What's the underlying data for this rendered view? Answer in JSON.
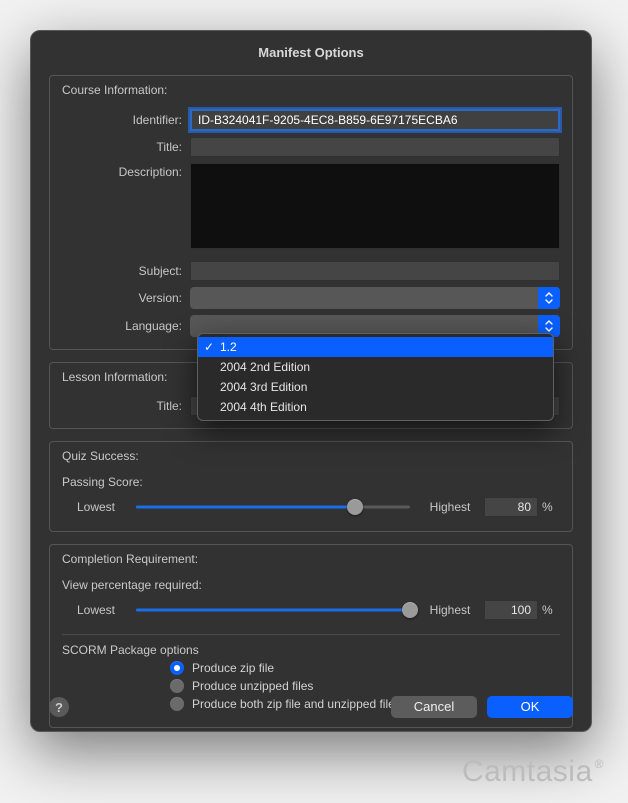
{
  "window": {
    "title": "Manifest Options"
  },
  "course": {
    "group_label": "Course Information:",
    "identifier_label": "Identifier:",
    "identifier_value": "ID-B324041F-9205-4EC8-B859-6E97175ECBA6",
    "title_label": "Title:",
    "title_value": "",
    "description_label": "Description:",
    "description_value": "",
    "subject_label": "Subject:",
    "subject_value": "",
    "version_label": "Version:",
    "version_value": "1.2",
    "version_options": {
      "o0": "1.2",
      "o1": "2004 2nd Edition",
      "o2": "2004 3rd Edition",
      "o3": "2004 4th Edition"
    },
    "language_label": "Language:"
  },
  "lesson": {
    "group_label": "Lesson Information:",
    "title_label": "Title:",
    "title_value": ""
  },
  "quiz": {
    "group_label": "Quiz Success:",
    "passing_label": "Passing Score:",
    "lowest": "Lowest",
    "highest": "Highest",
    "value": "80",
    "pct": "%"
  },
  "completion": {
    "group_label": "Completion Requirement:",
    "view_label": "View percentage required:",
    "lowest": "Lowest",
    "highest": "Highest",
    "value": "100",
    "pct": "%"
  },
  "scorm": {
    "group_label": "SCORM Package options",
    "r0": "Produce zip file",
    "r1": "Produce unzipped files",
    "r2": "Produce both zip file and unzipped files"
  },
  "footer": {
    "help": "?",
    "cancel": "Cancel",
    "ok": "OK"
  },
  "brand": "Camtasia"
}
